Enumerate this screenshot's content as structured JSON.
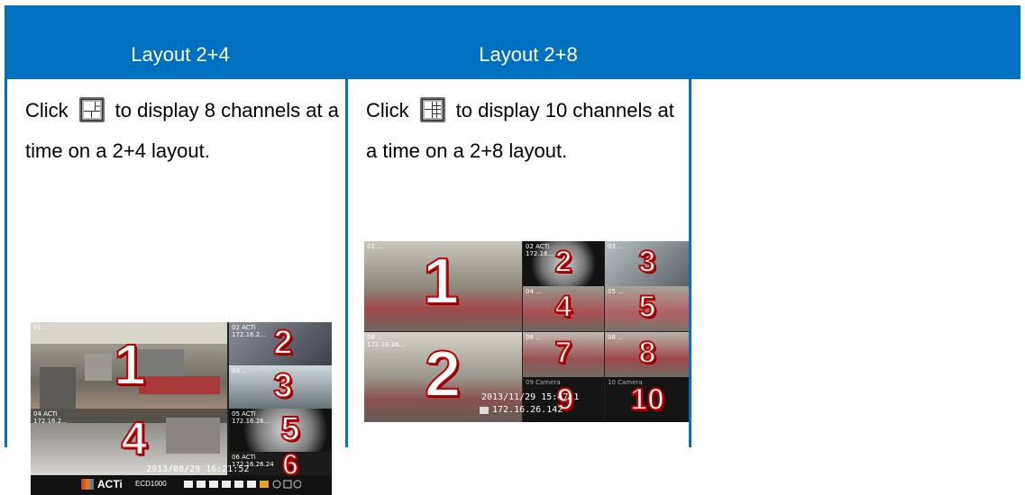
{
  "header": {
    "col1_title": "Layout 2+4",
    "col2_title": "Layout 2+8"
  },
  "col1": {
    "text_before": "Click",
    "text_after": "to display 8 channels at a time on a 2+4 layout.",
    "icon": "layout-2-4-icon",
    "screenshot": {
      "timestamp": "2013/08/29 16:21:52",
      "brand": "ACTi",
      "model": "ECD1000",
      "tiles": [
        {
          "n": "1",
          "label": "01 ..."
        },
        {
          "n": "2",
          "label": "02 ACTi\n172.16.2..."
        },
        {
          "n": "3",
          "label": "03 ..."
        },
        {
          "n": "4",
          "label": "04 ACTi\n172.16.2..."
        },
        {
          "n": "5",
          "label": "05 ACTi\n172.16.26..."
        },
        {
          "n": "6",
          "label": "06 ACTi\n172.16.26.24"
        }
      ]
    }
  },
  "col2": {
    "text_before": "Click",
    "text_after": "to display 10 channels at a time on a 2+8 layout.",
    "icon": "layout-2-8-icon",
    "screenshot": {
      "timestamp": "2013/11/29 15:47:1",
      "ip": "172.16.26.142",
      "tiles": [
        {
          "n": "1",
          "label": "01 ..."
        },
        {
          "n": "2",
          "label": "02 ACTi\n172.16..."
        },
        {
          "n": "3",
          "label": "03 ..."
        },
        {
          "n": "4",
          "label": "04 ..."
        },
        {
          "n": "5",
          "label": "05 ..."
        },
        {
          "n": "2",
          "label": "06 ...\n172.16.26..."
        },
        {
          "n": "7",
          "label": "06 ..."
        },
        {
          "n": "8",
          "label": "08 ..."
        },
        {
          "n": "9",
          "label": "09 Camera"
        },
        {
          "n": "10",
          "label": "10 Camera"
        }
      ]
    }
  },
  "colors": {
    "header_bg": "#0070c0",
    "border": "#0070c0",
    "number_outline": "#c00000"
  }
}
